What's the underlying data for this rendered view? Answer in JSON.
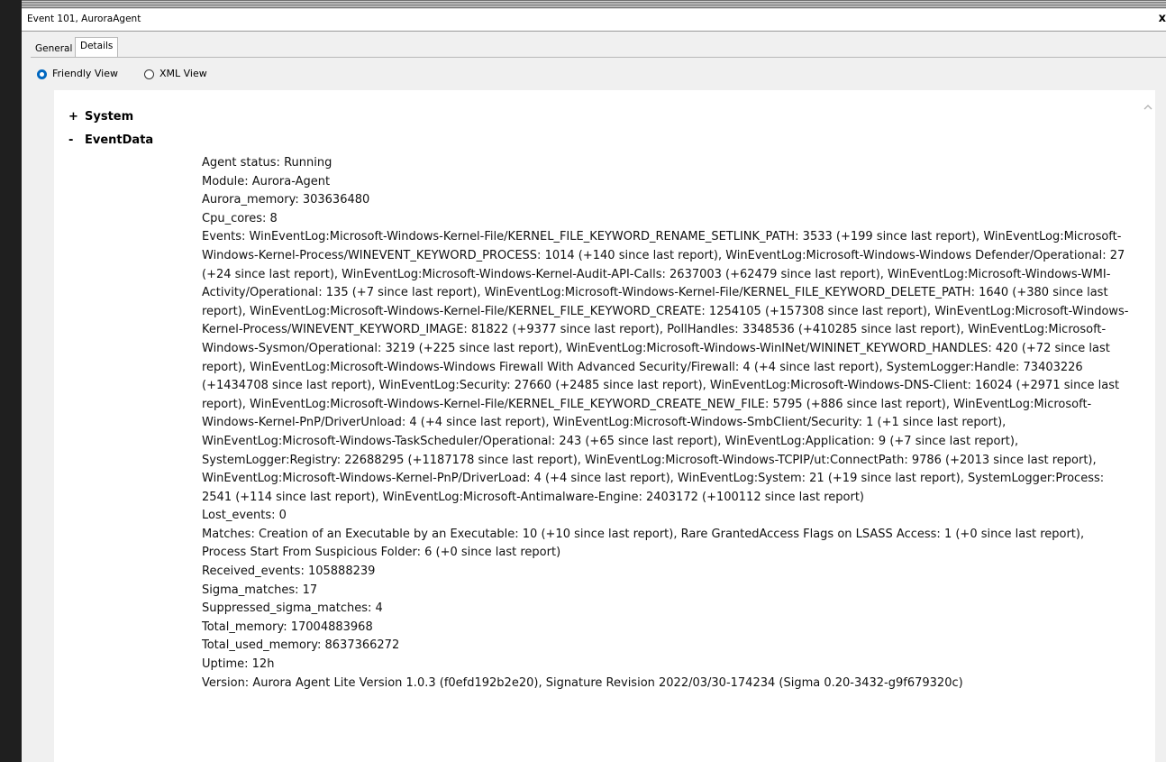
{
  "window": {
    "title": "Event 101, AuroraAgent",
    "close_glyph": "x"
  },
  "tabs": [
    {
      "label": "General",
      "active": false
    },
    {
      "label": "Details",
      "active": true
    }
  ],
  "view_options": [
    {
      "label": "Friendly View",
      "selected": true
    },
    {
      "label": "XML View",
      "selected": false
    }
  ],
  "tree": {
    "system": {
      "toggle": "+",
      "label": "System"
    },
    "eventdata": {
      "toggle": "-",
      "label": "EventData"
    }
  },
  "event_data": [
    "Agent status: Running",
    "Module: Aurora-Agent",
    "Aurora_memory: 303636480",
    "Cpu_cores: 8",
    "Events: WinEventLog:Microsoft-Windows-Kernel-File/KERNEL_FILE_KEYWORD_RENAME_SETLINK_PATH: 3533 (+199 since last report), WinEventLog:Microsoft-Windows-Kernel-Process/WINEVENT_KEYWORD_PROCESS: 1014 (+140 since last report), WinEventLog:Microsoft-Windows-Windows Defender/Operational: 27 (+24 since last report), WinEventLog:Microsoft-Windows-Kernel-Audit-API-Calls: 2637003 (+62479 since last report), WinEventLog:Microsoft-Windows-WMI-Activity/Operational: 135 (+7 since last report), WinEventLog:Microsoft-Windows-Kernel-File/KERNEL_FILE_KEYWORD_DELETE_PATH: 1640 (+380 since last report), WinEventLog:Microsoft-Windows-Kernel-File/KERNEL_FILE_KEYWORD_CREATE: 1254105 (+157308 since last report), WinEventLog:Microsoft-Windows-Kernel-Process/WINEVENT_KEYWORD_IMAGE: 81822 (+9377 since last report), PollHandles: 3348536 (+410285 since last report), WinEventLog:Microsoft-Windows-Sysmon/Operational: 3219 (+225 since last report), WinEventLog:Microsoft-Windows-WinINet/WININET_KEYWORD_HANDLES: 420 (+72 since last report), WinEventLog:Microsoft-Windows-Windows Firewall With Advanced Security/Firewall: 4 (+4 since last report), SystemLogger:Handle: 73403226 (+1434708 since last report), WinEventLog:Security: 27660 (+2485 since last report), WinEventLog:Microsoft-Windows-DNS-Client: 16024 (+2971 since last report), WinEventLog:Microsoft-Windows-Kernel-File/KERNEL_FILE_KEYWORD_CREATE_NEW_FILE: 5795 (+886 since last report), WinEventLog:Microsoft-Windows-Kernel-PnP/DriverUnload: 4 (+4 since last report), WinEventLog:Microsoft-Windows-SmbClient/Security: 1 (+1 since last report), WinEventLog:Microsoft-Windows-TaskScheduler/Operational: 243 (+65 since last report), WinEventLog:Application: 9 (+7 since last report), SystemLogger:Registry: 22688295 (+1187178 since last report), WinEventLog:Microsoft-Windows-TCPIP/ut:ConnectPath: 9786 (+2013 since last report), WinEventLog:Microsoft-Windows-Kernel-PnP/DriverLoad: 4 (+4 since last report), WinEventLog:System: 21 (+19 since last report), SystemLogger:Process: 2541 (+114 since last report), WinEventLog:Microsoft-Antimalware-Engine: 2403172 (+100112 since last report)",
    "Lost_events: 0",
    "Matches: Creation of an Executable by an Executable: 10 (+10 since last report), Rare GrantedAccess Flags on LSASS Access: 1 (+0 since last report), Process Start From Suspicious Folder: 6 (+0 since last report)",
    "Received_events: 105888239",
    "Sigma_matches: 17",
    "Suppressed_sigma_matches: 4",
    "Total_memory: 17004883968",
    "Total_used_memory: 8637366272",
    "Uptime: 12h",
    "Version: Aurora Agent Lite Version 1.0.3 (f0efd192b2e20), Signature Revision 2022/03/30-174234 (Sigma 0.20-3432-g9f679320c)"
  ],
  "colors": {
    "radio_accent": "#0067c0",
    "dialog_bg": "#f0f0f0",
    "content_bg": "#ffffff",
    "desktop_bg": "#1e1e1e"
  },
  "icons": {
    "close": "close-icon",
    "scroll_up": "chevron-up-icon"
  }
}
